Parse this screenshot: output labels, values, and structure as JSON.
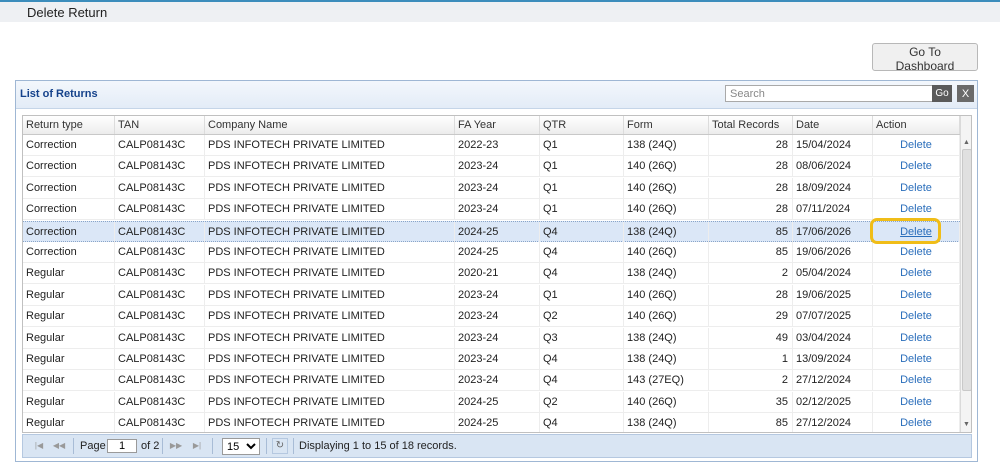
{
  "page": {
    "title": "Delete Return"
  },
  "dashboard_button": {
    "label": "Go To Dashboard"
  },
  "panel": {
    "title": "List of Returns",
    "search_placeholder": "Search",
    "go_label": "Go",
    "clear_label": "X"
  },
  "columns": [
    "Return type",
    "TAN",
    "Company Name",
    "FA Year",
    "QTR",
    "Form",
    "Total Records",
    "Date",
    "Action"
  ],
  "rows": [
    {
      "type": "Correction",
      "tan": "CALP08143C",
      "company": "PDS INFOTECH PRIVATE LIMITED",
      "fy": "2022-23",
      "qtr": "Q1",
      "form": "138 (24Q)",
      "records": "28",
      "date": "15/04/2024",
      "action": "Delete"
    },
    {
      "type": "Correction",
      "tan": "CALP08143C",
      "company": "PDS INFOTECH PRIVATE LIMITED",
      "fy": "2023-24",
      "qtr": "Q1",
      "form": "140 (26Q)",
      "records": "28",
      "date": "08/06/2024",
      "action": "Delete"
    },
    {
      "type": "Correction",
      "tan": "CALP08143C",
      "company": "PDS INFOTECH PRIVATE LIMITED",
      "fy": "2023-24",
      "qtr": "Q1",
      "form": "140 (26Q)",
      "records": "28",
      "date": "18/09/2024",
      "action": "Delete"
    },
    {
      "type": "Correction",
      "tan": "CALP08143C",
      "company": "PDS INFOTECH PRIVATE LIMITED",
      "fy": "2023-24",
      "qtr": "Q1",
      "form": "140 (26Q)",
      "records": "28",
      "date": "07/11/2024",
      "action": "Delete"
    },
    {
      "type": "Correction",
      "tan": "CALP08143C",
      "company": "PDS INFOTECH PRIVATE LIMITED",
      "fy": "2024-25",
      "qtr": "Q4",
      "form": "138 (24Q)",
      "records": "85",
      "date": "17/06/2026",
      "action": "Delete"
    },
    {
      "type": "Correction",
      "tan": "CALP08143C",
      "company": "PDS INFOTECH PRIVATE LIMITED",
      "fy": "2024-25",
      "qtr": "Q4",
      "form": "140 (26Q)",
      "records": "85",
      "date": "19/06/2026",
      "action": "Delete"
    },
    {
      "type": "Regular",
      "tan": "CALP08143C",
      "company": "PDS INFOTECH PRIVATE LIMITED",
      "fy": "2020-21",
      "qtr": "Q4",
      "form": "138 (24Q)",
      "records": "2",
      "date": "05/04/2024",
      "action": "Delete"
    },
    {
      "type": "Regular",
      "tan": "CALP08143C",
      "company": "PDS INFOTECH PRIVATE LIMITED",
      "fy": "2023-24",
      "qtr": "Q1",
      "form": "140 (26Q)",
      "records": "28",
      "date": "19/06/2025",
      "action": "Delete"
    },
    {
      "type": "Regular",
      "tan": "CALP08143C",
      "company": "PDS INFOTECH PRIVATE LIMITED",
      "fy": "2023-24",
      "qtr": "Q2",
      "form": "140 (26Q)",
      "records": "29",
      "date": "07/07/2025",
      "action": "Delete"
    },
    {
      "type": "Regular",
      "tan": "CALP08143C",
      "company": "PDS INFOTECH PRIVATE LIMITED",
      "fy": "2023-24",
      "qtr": "Q3",
      "form": "138 (24Q)",
      "records": "49",
      "date": "03/04/2024",
      "action": "Delete"
    },
    {
      "type": "Regular",
      "tan": "CALP08143C",
      "company": "PDS INFOTECH PRIVATE LIMITED",
      "fy": "2023-24",
      "qtr": "Q4",
      "form": "138 (24Q)",
      "records": "1",
      "date": "13/09/2024",
      "action": "Delete"
    },
    {
      "type": "Regular",
      "tan": "CALP08143C",
      "company": "PDS INFOTECH PRIVATE LIMITED",
      "fy": "2023-24",
      "qtr": "Q4",
      "form": "143 (27EQ)",
      "records": "2",
      "date": "27/12/2024",
      "action": "Delete"
    },
    {
      "type": "Regular",
      "tan": "CALP08143C",
      "company": "PDS INFOTECH PRIVATE LIMITED",
      "fy": "2024-25",
      "qtr": "Q2",
      "form": "140 (26Q)",
      "records": "35",
      "date": "02/12/2025",
      "action": "Delete"
    },
    {
      "type": "Regular",
      "tan": "CALP08143C",
      "company": "PDS INFOTECH PRIVATE LIMITED",
      "fy": "2024-25",
      "qtr": "Q4",
      "form": "138 (24Q)",
      "records": "85",
      "date": "27/12/2024",
      "action": "Delete"
    }
  ],
  "selected_row": 4,
  "pager": {
    "page_label": "Page",
    "current_page": "1",
    "of_label": "of 2",
    "page_size": "15",
    "page_size_options": [
      "15"
    ],
    "summary": "Displaying 1 to 15 of 18 records."
  },
  "colors": {
    "accent": "#3c8dbc",
    "link": "#2a6ebb",
    "highlight": "#f0bd18",
    "selected_row": "#dbe7f7"
  }
}
